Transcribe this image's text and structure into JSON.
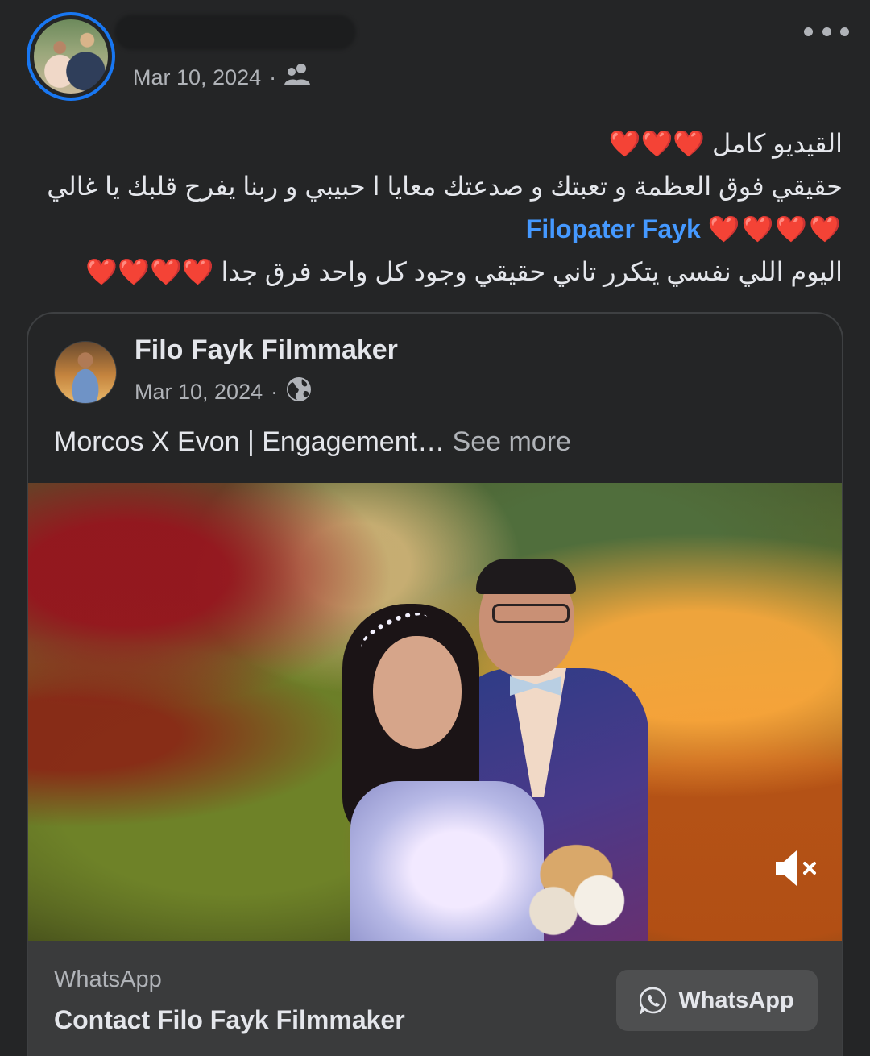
{
  "post": {
    "date": "Mar 10, 2024",
    "separator": "·",
    "audience_icon": "friends-icon",
    "text_lines": [
      "القيديو كامل",
      "حقيقي فوق العظمة و تعبتك و صدعتك معايا ا حبيبي و ربنا يفرح قلبك يا غالي",
      "Filopater Fayk",
      "اليوم اللي نفسي يتكرر تاني حقيقي وجود كل واحد فرق جدا"
    ],
    "hearts": {
      "line1": "❤️❤️❤️",
      "line3": "❤️❤️❤️❤️",
      "line4": "❤️❤️❤️❤️"
    },
    "mention": "Filopater Fayk"
  },
  "shared_post": {
    "page_name": "Filo Fayk Filmmaker",
    "date": "Mar 10, 2024",
    "separator": "·",
    "audience_icon": "globe-icon",
    "caption": "Morcos X Evon | Engagement…",
    "see_more_label": "See more"
  },
  "video": {
    "muted": true,
    "mute_icon": "speaker-muted-icon"
  },
  "cta": {
    "source_label": "WhatsApp",
    "title": "Contact Filo Fayk Filmmaker",
    "button_label": "WhatsApp",
    "button_icon": "whatsapp-icon"
  },
  "colors": {
    "background": "#242526",
    "card_border": "#3e4042",
    "cta_background": "#3a3b3c",
    "button_background": "#4e4f50",
    "mention_blue": "#4599ff",
    "avatar_ring_blue": "#1877f2",
    "text_primary": "#e4e6eb",
    "text_secondary": "#b0b3b8",
    "heart_red": "#f02849"
  }
}
